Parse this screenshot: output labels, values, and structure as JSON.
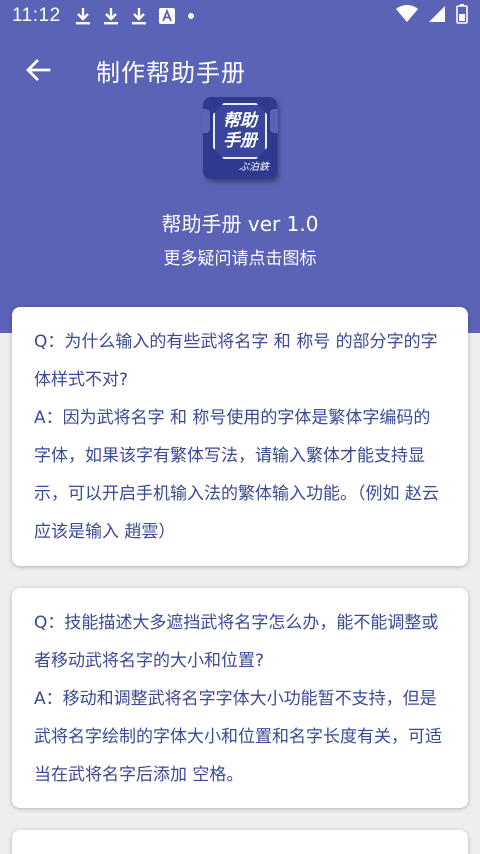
{
  "statusbar": {
    "time": "11:12",
    "icons_left": [
      "download-icon",
      "download-icon",
      "download-icon",
      "a-box-icon",
      "dot-icon"
    ],
    "icons_right": [
      "wifi-icon",
      "cellular-icon",
      "battery-icon"
    ]
  },
  "toolbar": {
    "back_icon": "arrow-left-icon",
    "title": "制作帮助手册"
  },
  "app_icon": {
    "text": "帮助手册",
    "signature": "ぷ泊鉄"
  },
  "version_text": "帮助手册 ver 1.0",
  "hint_text": "更多疑问请点击图标",
  "faq": [
    {
      "q": "Q：为什么输入的有些武将名字 和 称号 的部分字的字体样式不对?",
      "a": "A：因为武将名字 和 称号使用的字体是繁体字编码的字体，如果该字有繁体写法，请输入繁体才能支持显示，可以开启手机输入法的繁体输入功能。（例如 赵云 应该是输入 趙雲）"
    },
    {
      "q": "Q：技能描述大多遮挡武将名字怎么办，能不能调整或者移动武将名字的大小和位置?",
      "a": "A：移动和调整武将名字字体大小功能暂不支持，但是武将名字绘制的字体大小和位置和名字长度有关，可适当在武将名字后添加 空格。"
    }
  ],
  "colors": {
    "header": "#5a63b5",
    "card_text": "#3b4a95",
    "background": "#eeeeee"
  }
}
